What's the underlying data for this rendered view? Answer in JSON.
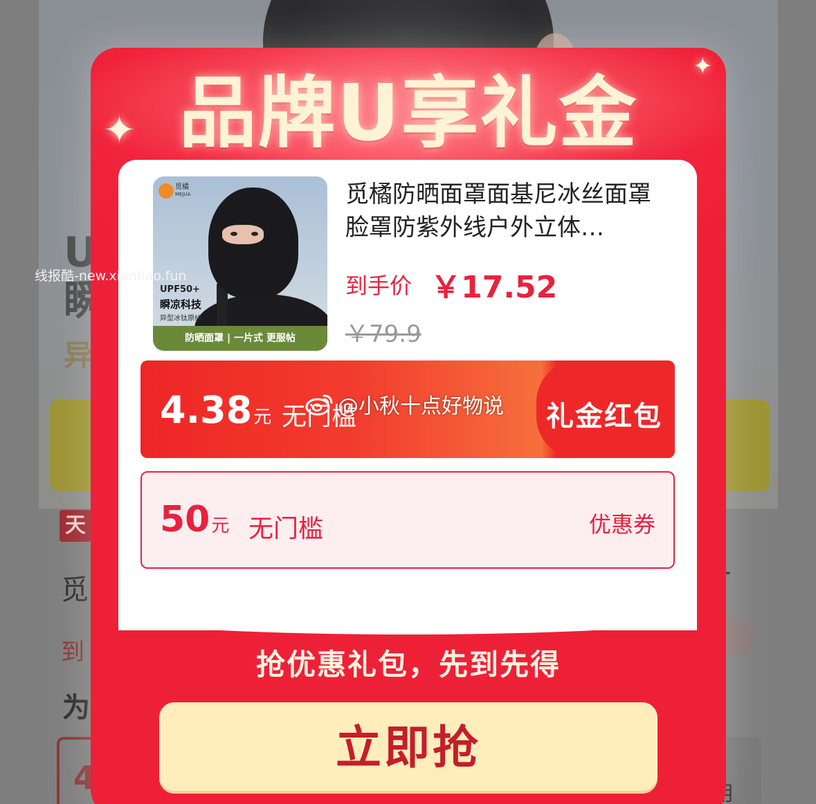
{
  "background": {
    "hero_heading_line1": "U",
    "hero_heading_line2": "瞬",
    "hero_subtitle": "异",
    "badge": "天",
    "row1": "觅",
    "row1_right": "T",
    "row2": "到",
    "row3": "为",
    "box_left": "4",
    "box_right": "用"
  },
  "popup": {
    "title": "品牌U享礼金",
    "product": {
      "image_brand": "觅橘",
      "image_brand_en": "MEJUA",
      "image_upf": "UPF50+",
      "image_tech": "瞬凉科技",
      "image_fabric": "异型冰钛原纱",
      "image_strip": "防晒面罩 | 一片式 更服帖",
      "name": "觅橘防晒面罩面基尼冰丝面罩脸罩防紫外线户外立体…",
      "price_label": "到手价",
      "price": "￥17.52",
      "original_price": "￥79.9"
    },
    "coupons": [
      {
        "amount": "4.38",
        "unit": "元",
        "condition": "无门槛",
        "type": "礼金红包"
      },
      {
        "amount": "50",
        "unit": "元",
        "condition": "无门槛",
        "type": "优惠券"
      }
    ],
    "slogan": "抢优惠礼包，先到先得",
    "button_label": "立即抢"
  },
  "overlays": {
    "watermark": "线报酷-new.xianbao.fun",
    "weibo_handle": "@小秋十点好物说"
  },
  "colors": {
    "popup_red": "#ee2038",
    "accent_red": "#e8223f",
    "button_bg": "#ffedbc",
    "button_text": "#c41e2c"
  }
}
